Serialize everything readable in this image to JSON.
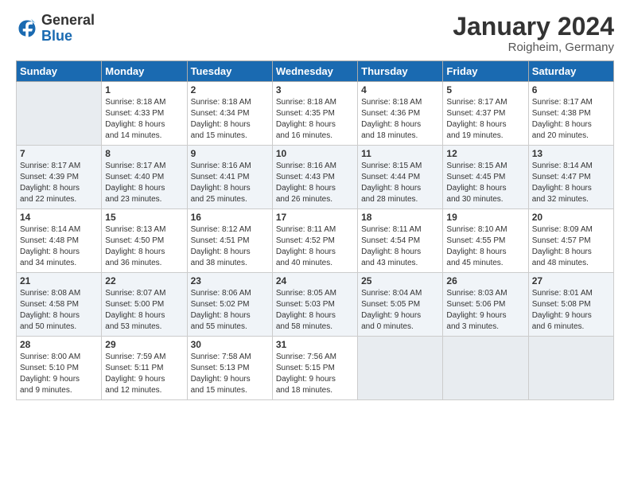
{
  "header": {
    "logo_general": "General",
    "logo_blue": "Blue",
    "title": "January 2024",
    "subtitle": "Roigheim, Germany"
  },
  "weekdays": [
    "Sunday",
    "Monday",
    "Tuesday",
    "Wednesday",
    "Thursday",
    "Friday",
    "Saturday"
  ],
  "weeks": [
    [
      {
        "day": "",
        "lines": []
      },
      {
        "day": "1",
        "lines": [
          "Sunrise: 8:18 AM",
          "Sunset: 4:33 PM",
          "Daylight: 8 hours",
          "and 14 minutes."
        ]
      },
      {
        "day": "2",
        "lines": [
          "Sunrise: 8:18 AM",
          "Sunset: 4:34 PM",
          "Daylight: 8 hours",
          "and 15 minutes."
        ]
      },
      {
        "day": "3",
        "lines": [
          "Sunrise: 8:18 AM",
          "Sunset: 4:35 PM",
          "Daylight: 8 hours",
          "and 16 minutes."
        ]
      },
      {
        "day": "4",
        "lines": [
          "Sunrise: 8:18 AM",
          "Sunset: 4:36 PM",
          "Daylight: 8 hours",
          "and 18 minutes."
        ]
      },
      {
        "day": "5",
        "lines": [
          "Sunrise: 8:17 AM",
          "Sunset: 4:37 PM",
          "Daylight: 8 hours",
          "and 19 minutes."
        ]
      },
      {
        "day": "6",
        "lines": [
          "Sunrise: 8:17 AM",
          "Sunset: 4:38 PM",
          "Daylight: 8 hours",
          "and 20 minutes."
        ]
      }
    ],
    [
      {
        "day": "7",
        "lines": [
          "Sunrise: 8:17 AM",
          "Sunset: 4:39 PM",
          "Daylight: 8 hours",
          "and 22 minutes."
        ]
      },
      {
        "day": "8",
        "lines": [
          "Sunrise: 8:17 AM",
          "Sunset: 4:40 PM",
          "Daylight: 8 hours",
          "and 23 minutes."
        ]
      },
      {
        "day": "9",
        "lines": [
          "Sunrise: 8:16 AM",
          "Sunset: 4:41 PM",
          "Daylight: 8 hours",
          "and 25 minutes."
        ]
      },
      {
        "day": "10",
        "lines": [
          "Sunrise: 8:16 AM",
          "Sunset: 4:43 PM",
          "Daylight: 8 hours",
          "and 26 minutes."
        ]
      },
      {
        "day": "11",
        "lines": [
          "Sunrise: 8:15 AM",
          "Sunset: 4:44 PM",
          "Daylight: 8 hours",
          "and 28 minutes."
        ]
      },
      {
        "day": "12",
        "lines": [
          "Sunrise: 8:15 AM",
          "Sunset: 4:45 PM",
          "Daylight: 8 hours",
          "and 30 minutes."
        ]
      },
      {
        "day": "13",
        "lines": [
          "Sunrise: 8:14 AM",
          "Sunset: 4:47 PM",
          "Daylight: 8 hours",
          "and 32 minutes."
        ]
      }
    ],
    [
      {
        "day": "14",
        "lines": [
          "Sunrise: 8:14 AM",
          "Sunset: 4:48 PM",
          "Daylight: 8 hours",
          "and 34 minutes."
        ]
      },
      {
        "day": "15",
        "lines": [
          "Sunrise: 8:13 AM",
          "Sunset: 4:50 PM",
          "Daylight: 8 hours",
          "and 36 minutes."
        ]
      },
      {
        "day": "16",
        "lines": [
          "Sunrise: 8:12 AM",
          "Sunset: 4:51 PM",
          "Daylight: 8 hours",
          "and 38 minutes."
        ]
      },
      {
        "day": "17",
        "lines": [
          "Sunrise: 8:11 AM",
          "Sunset: 4:52 PM",
          "Daylight: 8 hours",
          "and 40 minutes."
        ]
      },
      {
        "day": "18",
        "lines": [
          "Sunrise: 8:11 AM",
          "Sunset: 4:54 PM",
          "Daylight: 8 hours",
          "and 43 minutes."
        ]
      },
      {
        "day": "19",
        "lines": [
          "Sunrise: 8:10 AM",
          "Sunset: 4:55 PM",
          "Daylight: 8 hours",
          "and 45 minutes."
        ]
      },
      {
        "day": "20",
        "lines": [
          "Sunrise: 8:09 AM",
          "Sunset: 4:57 PM",
          "Daylight: 8 hours",
          "and 48 minutes."
        ]
      }
    ],
    [
      {
        "day": "21",
        "lines": [
          "Sunrise: 8:08 AM",
          "Sunset: 4:58 PM",
          "Daylight: 8 hours",
          "and 50 minutes."
        ]
      },
      {
        "day": "22",
        "lines": [
          "Sunrise: 8:07 AM",
          "Sunset: 5:00 PM",
          "Daylight: 8 hours",
          "and 53 minutes."
        ]
      },
      {
        "day": "23",
        "lines": [
          "Sunrise: 8:06 AM",
          "Sunset: 5:02 PM",
          "Daylight: 8 hours",
          "and 55 minutes."
        ]
      },
      {
        "day": "24",
        "lines": [
          "Sunrise: 8:05 AM",
          "Sunset: 5:03 PM",
          "Daylight: 8 hours",
          "and 58 minutes."
        ]
      },
      {
        "day": "25",
        "lines": [
          "Sunrise: 8:04 AM",
          "Sunset: 5:05 PM",
          "Daylight: 9 hours",
          "and 0 minutes."
        ]
      },
      {
        "day": "26",
        "lines": [
          "Sunrise: 8:03 AM",
          "Sunset: 5:06 PM",
          "Daylight: 9 hours",
          "and 3 minutes."
        ]
      },
      {
        "day": "27",
        "lines": [
          "Sunrise: 8:01 AM",
          "Sunset: 5:08 PM",
          "Daylight: 9 hours",
          "and 6 minutes."
        ]
      }
    ],
    [
      {
        "day": "28",
        "lines": [
          "Sunrise: 8:00 AM",
          "Sunset: 5:10 PM",
          "Daylight: 9 hours",
          "and 9 minutes."
        ]
      },
      {
        "day": "29",
        "lines": [
          "Sunrise: 7:59 AM",
          "Sunset: 5:11 PM",
          "Daylight: 9 hours",
          "and 12 minutes."
        ]
      },
      {
        "day": "30",
        "lines": [
          "Sunrise: 7:58 AM",
          "Sunset: 5:13 PM",
          "Daylight: 9 hours",
          "and 15 minutes."
        ]
      },
      {
        "day": "31",
        "lines": [
          "Sunrise: 7:56 AM",
          "Sunset: 5:15 PM",
          "Daylight: 9 hours",
          "and 18 minutes."
        ]
      },
      {
        "day": "",
        "lines": []
      },
      {
        "day": "",
        "lines": []
      },
      {
        "day": "",
        "lines": []
      }
    ]
  ]
}
